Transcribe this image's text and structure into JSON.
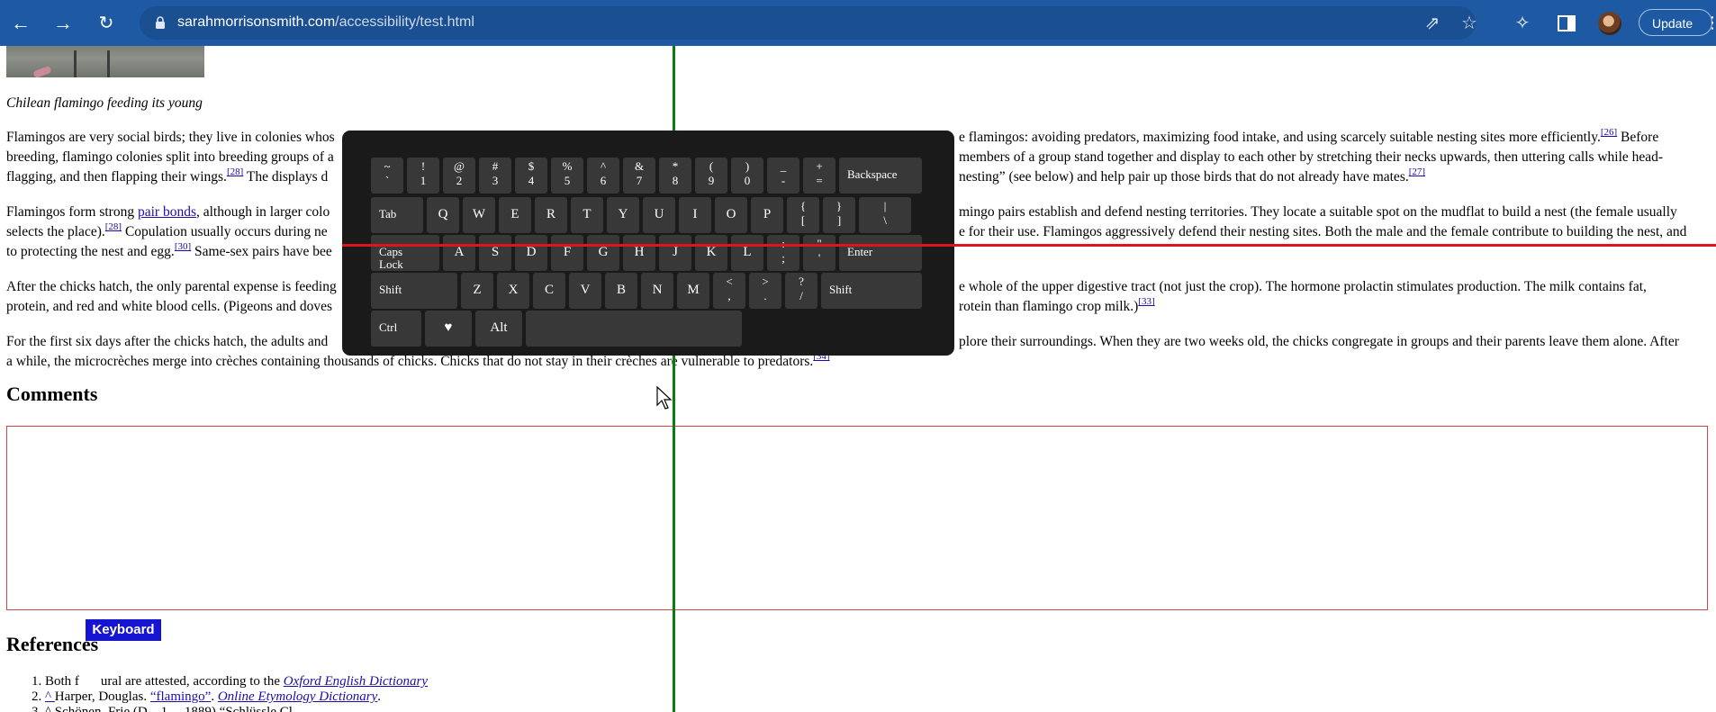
{
  "browser": {
    "url_domain": "sarahmorrisonsmith.com",
    "url_path": "/accessibility/test.html",
    "update_label": "Update"
  },
  "article": {
    "image_alt": "Chilean flamingo feeding its young",
    "caption": "Chilean flamingo feeding its young",
    "p1": {
      "line1_left": "Flamingos are very social birds; they live in colonies whos",
      "line1_right": "e flamingos: avoiding predators, maximizing food intake, and using scarcely suitable nesting sites more efficiently.",
      "ref_26": "[26]",
      "line1_end": " Before",
      "line2_left": "breeding, flamingo colonies split into breeding groups of a",
      "line2_right": " members of a group stand together and display to each other by stretching their necks upwards, then uttering calls while head-",
      "line3_left": "flagging, and then flapping their wings.",
      "ref_28": "[28]",
      "line3_mid": " The displays d",
      "line3_right": "nesting” (see below) and help pair up those birds that do not already have mates.",
      "ref_27": "[27]"
    },
    "p2": {
      "line1_left": "Flamingos form strong ",
      "pair_bonds_link": "pair bonds",
      "line1_mid": ", although in larger colo",
      "line1_right": "mingo pairs establish and defend nesting territories. They locate a suitable spot on the mudflat to build a nest (the female usually",
      "line2_left": "selects the place).",
      "ref_28": "[28]",
      "line2_mid": " Copulation usually occurs during ne",
      "line2_right": "e for their use. Flamingos aggressively defend their nesting sites. Both the male and the female contribute to building the nest, and",
      "line3_left": "to protecting the nest and egg.",
      "ref_30": "[30]",
      "line3_mid": " Same-sex pairs have bee"
    },
    "p3": {
      "line1_left": "After the chicks hatch, the only parental expense is feeding",
      "line1_right": "e whole of the upper digestive tract (not just the crop). The hormone prolactin stimulates production. The milk contains fat,",
      "line2_left": "protein, and red and white blood cells. (Pigeons and doves",
      "line2_right": "rotein than flamingo crop milk.)",
      "ref_33": "[33]"
    },
    "p4": {
      "line1_left": "For the first six days after the chicks hatch, the adults and",
      "line1_right": "plore their surroundings. When they are two weeks old, the chicks congregate in groups and their parents leave them alone. After",
      "line2": "a while, the microcrèches merge into crèches containing thousands of chicks. Chicks that do not stay in their crèches are vulnerable to predators.",
      "ref_34": "[34]"
    }
  },
  "comments": {
    "heading": "Comments",
    "textarea_value": ""
  },
  "references": {
    "heading": "References",
    "items": [
      {
        "marker": "Both f",
        "after_overlay": "ural are attested, according to the ",
        "link": "Oxford English Dictionary"
      },
      {
        "marker": "^ ",
        "text": "Harper, Douglas. ",
        "link1": "“flamingo”",
        "sep": ". ",
        "link2": "Online Etymology Dictionary",
        "end": "."
      },
      {
        "text": "^ Schönen, Frie (D... 1 ... 1889) “Schlüssle Cl..."
      }
    ]
  },
  "keyboard_tab": {
    "label": "Keyboard",
    "color": "#1414d2"
  },
  "scan_lines": {
    "vertical_color": "#0b7d10",
    "horizontal_color": "#e0121c"
  },
  "osk": {
    "row1": [
      {
        "top": "~",
        "bottom": "`"
      },
      {
        "top": "!",
        "bottom": "1"
      },
      {
        "top": "@",
        "bottom": "2"
      },
      {
        "top": "#",
        "bottom": "3"
      },
      {
        "top": "$",
        "bottom": "4"
      },
      {
        "top": "%",
        "bottom": "5"
      },
      {
        "top": "^",
        "bottom": "6"
      },
      {
        "top": "&",
        "bottom": "7"
      },
      {
        "top": "*",
        "bottom": "8"
      },
      {
        "top": "(",
        "bottom": "9"
      },
      {
        "top": ")",
        "bottom": "0"
      },
      {
        "top": "_",
        "bottom": "-"
      },
      {
        "top": "+",
        "bottom": "="
      },
      {
        "label": "Backspace"
      }
    ],
    "row2": [
      {
        "label": "Tab"
      },
      {
        "char": "Q"
      },
      {
        "char": "W"
      },
      {
        "char": "E"
      },
      {
        "char": "R"
      },
      {
        "char": "T"
      },
      {
        "char": "Y"
      },
      {
        "char": "U"
      },
      {
        "char": "I"
      },
      {
        "char": "O"
      },
      {
        "char": "P"
      },
      {
        "top": "{",
        "bottom": "["
      },
      {
        "top": "}",
        "bottom": "]"
      },
      {
        "top": "|",
        "bottom": "\\"
      }
    ],
    "row3": [
      {
        "label": "Caps\nLock"
      },
      {
        "char": "A"
      },
      {
        "char": "S"
      },
      {
        "char": "D"
      },
      {
        "char": "F"
      },
      {
        "char": "G"
      },
      {
        "char": "H"
      },
      {
        "char": "J"
      },
      {
        "char": "K"
      },
      {
        "char": "L"
      },
      {
        "top": ":",
        "bottom": ";"
      },
      {
        "top": "\"",
        "bottom": "'"
      },
      {
        "label": "Enter"
      }
    ],
    "row4": [
      {
        "label": "Shift"
      },
      {
        "char": "Z"
      },
      {
        "char": "X"
      },
      {
        "char": "C"
      },
      {
        "char": "V"
      },
      {
        "char": "B"
      },
      {
        "char": "N"
      },
      {
        "char": "M"
      },
      {
        "top": "<",
        "bottom": ","
      },
      {
        "top": ">",
        "bottom": "."
      },
      {
        "top": "?",
        "bottom": "/"
      },
      {
        "label": "Shift"
      }
    ],
    "row5": [
      {
        "label": "Ctrl"
      },
      {
        "char": "♥"
      },
      {
        "char": "Alt"
      },
      {
        "label": ""
      }
    ]
  }
}
